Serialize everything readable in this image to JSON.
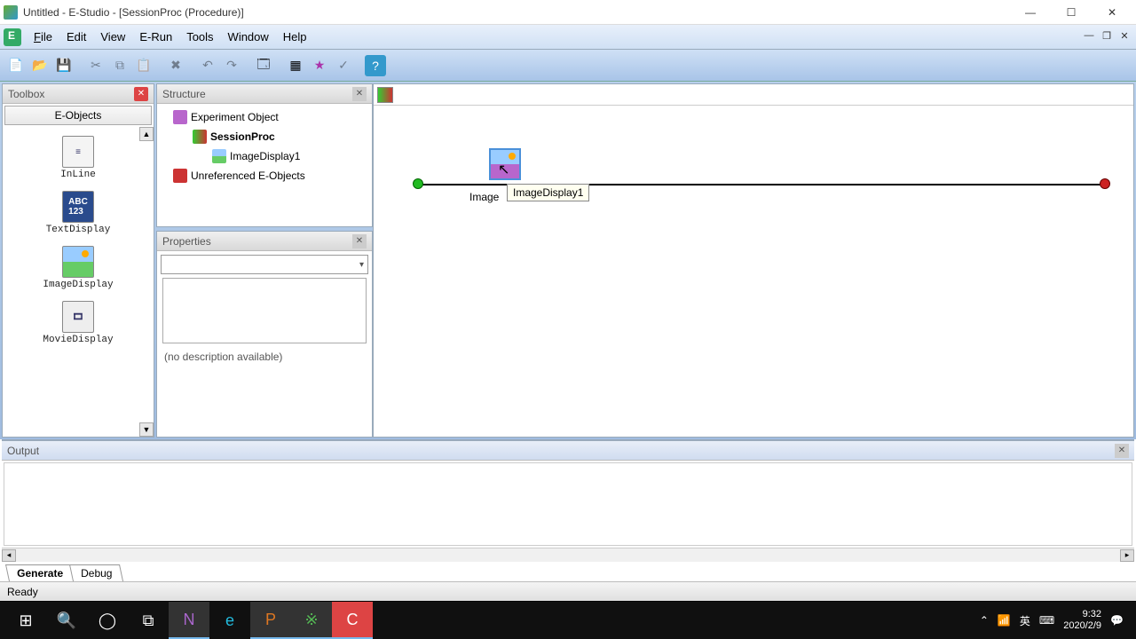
{
  "titlebar": {
    "title": "Untitled - E-Studio - [SessionProc  (Procedure)]"
  },
  "menu": {
    "file": "File",
    "edit": "Edit",
    "view": "View",
    "erun": "E-Run",
    "tools": "Tools",
    "window": "Window",
    "help": "Help"
  },
  "toolbox": {
    "title": "Toolbox",
    "tab": "E-Objects",
    "items": {
      "inline": "InLine",
      "textdisplay": "TextDisplay",
      "imagedisplay": "ImageDisplay",
      "moviedisplay": "MovieDisplay"
    }
  },
  "structure": {
    "title": "Structure",
    "experiment": "Experiment Object",
    "sessionproc": "SessionProc",
    "imagedisplay1": "ImageDisplay1",
    "unref": "Unreferenced E-Objects"
  },
  "properties": {
    "title": "Properties",
    "desc": "(no description available)"
  },
  "canvas": {
    "obj_label": "Image",
    "tooltip": "ImageDisplay1"
  },
  "output": {
    "title": "Output",
    "tabs": {
      "generate": "Generate",
      "debug": "Debug"
    }
  },
  "status": {
    "ready": "Ready"
  },
  "taskbar": {
    "ime_lang": "英",
    "time": "9:32",
    "date": "2020/2/9"
  }
}
